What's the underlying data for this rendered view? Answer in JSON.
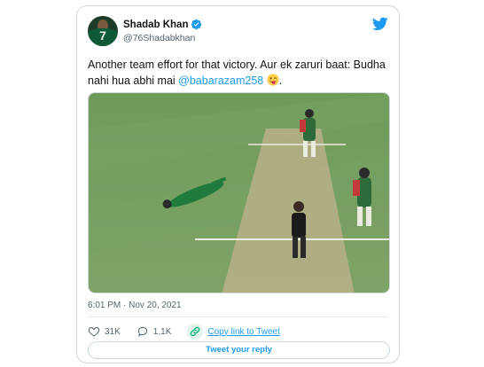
{
  "tweet": {
    "author": {
      "display_name": "Shadab Khan",
      "handle": "@76Shadabkhan",
      "avatar_jersey_number": "7",
      "verified": true
    },
    "text_part1": "Another team effort for that victory. Aur ek zaruri baat: Budha nahi hua abhi mai ",
    "mention": "@babarazam258",
    "text_part2": ".",
    "emoji": "winking-face-with-tongue",
    "timestamp": "6:01 PM · Nov 20, 2021",
    "likes_count": "31K",
    "replies_count": "1.1K",
    "copy_link_label": "Copy link to Tweet",
    "reply_button_label": "Tweet your reply"
  },
  "colors": {
    "accent": "#1d9bf0",
    "like_red": "#f91880",
    "copy_green": "#00ba7c",
    "border": "#cfd9de",
    "muted_text": "#536471"
  },
  "icons": {
    "brand": "twitter-bird-icon",
    "verified": "verified-badge-icon",
    "like": "heart-icon",
    "reply": "reply-bubble-icon",
    "copy": "link-icon"
  }
}
